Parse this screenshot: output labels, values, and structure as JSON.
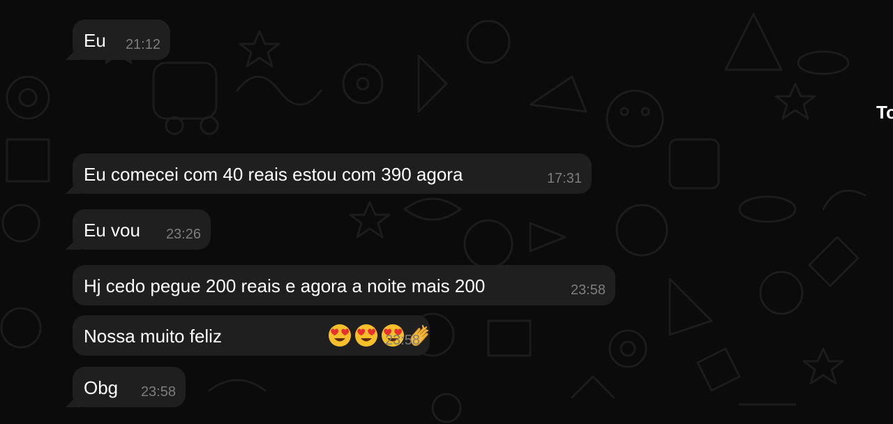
{
  "messages": [
    {
      "text": "Eu",
      "time": "21:12"
    },
    {
      "text": "Eu comecei com 40 reais estou com 390 agora",
      "time": "17:31"
    },
    {
      "text": "Eu vou",
      "time": "23:26"
    },
    {
      "text": "Hj cedo pegue 200 reais e agora a noite mais 200",
      "time": "23:58"
    },
    {
      "text": "Nossa muito feliz",
      "time": "23:58",
      "emojis": [
        "heart-eyes",
        "heart-eyes",
        "heart-eyes",
        "clapping-hands"
      ]
    },
    {
      "text": "Obg",
      "time": "23:58"
    }
  ],
  "edge_text": "To",
  "colors": {
    "background": "#0b0b0b",
    "bubble": "#1f1f1f",
    "text": "#ffffff",
    "time": "#7d7d7d",
    "doodle": "#1c1c1c"
  }
}
